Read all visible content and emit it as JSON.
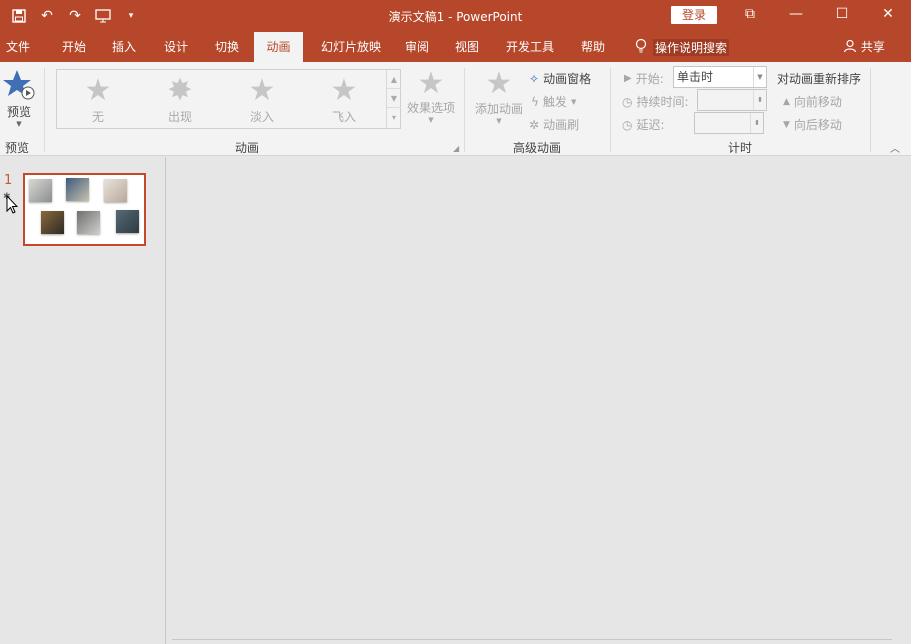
{
  "window": {
    "title": "演示文稿1 - PowerPoint",
    "login_label": "登录"
  },
  "quick_access": [
    "save-icon",
    "undo-icon",
    "redo-icon",
    "present-icon",
    "customize-icon"
  ],
  "tabs": [
    {
      "label": "文件"
    },
    {
      "label": "开始"
    },
    {
      "label": "插入"
    },
    {
      "label": "设计"
    },
    {
      "label": "切换"
    },
    {
      "label": "动画"
    },
    {
      "label": "幻灯片放映"
    },
    {
      "label": "审阅"
    },
    {
      "label": "视图"
    },
    {
      "label": "开发工具"
    },
    {
      "label": "帮助"
    }
  ],
  "active_tab": "动画",
  "tell_me": "操作说明搜索",
  "share": "共享",
  "ribbon": {
    "preview": {
      "button": "预览",
      "group": "预览"
    },
    "animation": {
      "group": "动画",
      "gallery": [
        "无",
        "出现",
        "淡入",
        "飞入"
      ],
      "effect_options": "效果选项"
    },
    "advanced": {
      "group": "高级动画",
      "add_animation": "添加动画",
      "animation_pane": "动画窗格",
      "trigger": "触发",
      "animation_painter": "动画刷"
    },
    "timing": {
      "group": "计时",
      "start_label": "开始:",
      "start_value": "单击时",
      "duration_label": "持续时间:",
      "delay_label": "延迟:",
      "reorder_title": "对动画重新排序",
      "move_earlier": "向前移动",
      "move_later": "向后移动"
    }
  },
  "slides": [
    {
      "number": "1"
    }
  ],
  "colors": {
    "accent": "#b7472a",
    "active_tab_text": "#b7472a",
    "thumb_border": "#c6472b"
  }
}
